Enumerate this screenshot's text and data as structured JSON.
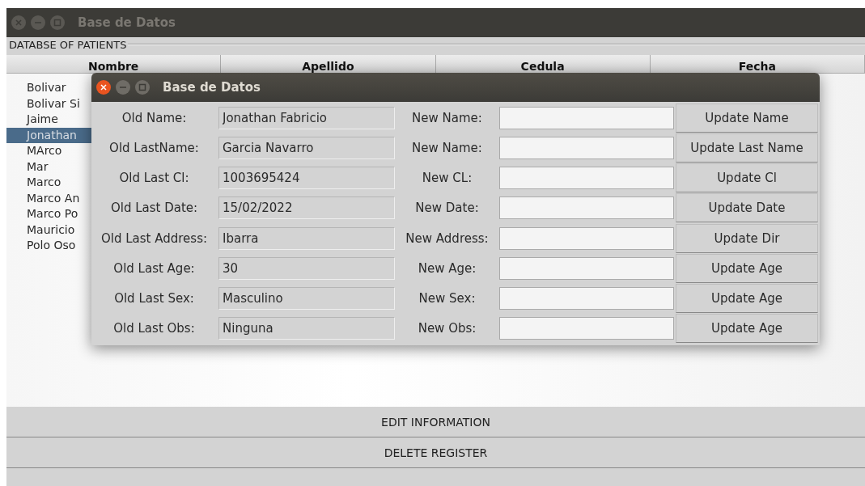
{
  "main_window": {
    "title": "Base de Datos",
    "panel_title": "DATABSE OF PATIENTS",
    "columns": [
      "Nombre",
      "Apellido",
      "Cedula",
      "Fecha"
    ],
    "rows": [
      {
        "name": "Bolivar",
        "selected": false
      },
      {
        "name": "Bolivar Si",
        "selected": false
      },
      {
        "name": "Jaime",
        "selected": false
      },
      {
        "name": "Jonathan",
        "selected": true
      },
      {
        "name": "MArco",
        "selected": false
      },
      {
        "name": "Mar",
        "selected": false
      },
      {
        "name": "Marco",
        "selected": false
      },
      {
        "name": "Marco An",
        "selected": false
      },
      {
        "name": "Marco Po",
        "selected": false
      },
      {
        "name": "Mauricio",
        "selected": false
      },
      {
        "name": "Polo Oso",
        "selected": false
      }
    ],
    "buttons": [
      "EDIT INFORMATION",
      "DELETE REGISTER"
    ]
  },
  "dialog": {
    "title": "Base de Datos",
    "fields": [
      {
        "old_label": "Old Name:",
        "old_value": "Jonathan Fabricio",
        "new_label": "New Name:",
        "button": "Update Name"
      },
      {
        "old_label": "Old LastName:",
        "old_value": "Garcia Navarro",
        "new_label": "New Name:",
        "button": "Update Last Name"
      },
      {
        "old_label": "Old Last Cl:",
        "old_value": "1003695424",
        "new_label": "New CL:",
        "button": "Update Cl"
      },
      {
        "old_label": "Old Last Date:",
        "old_value": "15/02/2022",
        "new_label": "New Date:",
        "button": "Update Date"
      },
      {
        "old_label": "Old Last Address:",
        "old_value": "Ibarra",
        "new_label": "New Address:",
        "button": "Update Dir"
      },
      {
        "old_label": "Old Last Age:",
        "old_value": "30",
        "new_label": "New Age:",
        "button": "Update Age"
      },
      {
        "old_label": "Old Last Sex:",
        "old_value": "Masculino",
        "new_label": "New Sex:",
        "button": "Update Age"
      },
      {
        "old_label": "Old Last Obs:",
        "old_value": "Ninguna",
        "new_label": "New Obs:",
        "button": "Update Age"
      }
    ]
  }
}
